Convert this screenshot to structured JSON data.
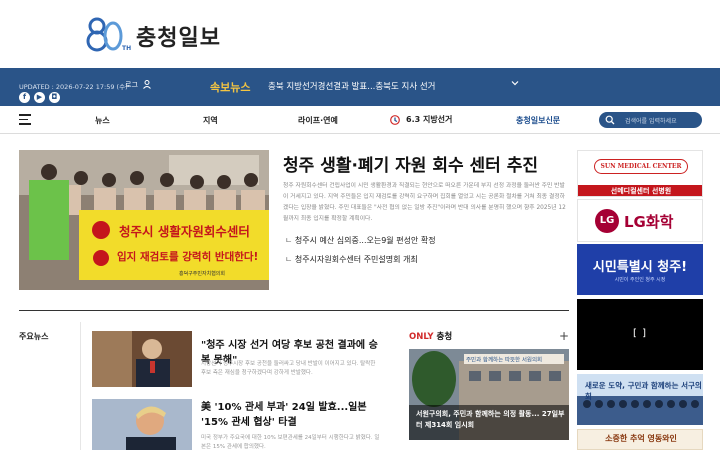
{
  "logo": {
    "anniversary": "80",
    "suffix": "TH",
    "name": "충청일보"
  },
  "topbar": {
    "updated": "UPDATED : 2026-07-22 17:59 (수)",
    "login": "로그",
    "breaking_label": "속보뉴스",
    "ticker_text": "충북 지방선거경선결과 발표...충북도 지사 선거",
    "social": [
      "f",
      "▶",
      "◘"
    ]
  },
  "nav": {
    "items": [
      "뉴스",
      "지역",
      "라이프·연예"
    ],
    "election": "6.3 지방선거",
    "highlight": "충청일보신문",
    "search_placeholder": "검색어를 입력하세요"
  },
  "hero": {
    "title": "청주 생활·폐기 자원 회수 센터 추진",
    "summary": "청주 자원회수센터 건립사업이 시민 생활환경과 직결되는 현안으로 떠오른 가운데 부지 선정 과정을 둘러싼 주민 반발이 거세지고 있다. 지역 주민들은 입지 재검토를 강력히 요구하며 집회를 열었고 시는 공론화 절차를 거쳐 최종 결정하겠다는 입장을 밝혔다. 주민 대표들은 \"사전 협의 없는 일방 추진\"이라며 반대 의사를 분명히 했으며 향후 2025년 12월까지 최종 입지를 확정할 계획이다.",
    "image_banner_line1": "청주시 생활자원회수센터",
    "image_banner_line2": "입지 재검토를 강력히 반대한다!",
    "image_banner_footer": "흥덕구주민자치협의회",
    "links": [
      "청주시 예산 심의중...오는9월 편성안 확정",
      "청주시자원회수센터 주민설명회 개최"
    ]
  },
  "left_section": {
    "label": "주요뉴스"
  },
  "news": [
    {
      "title": "\"청주 시장 선거 여당 후보 공천 결과에 승복 못해\"",
      "desc": "지방선거 청주시장 후보 공천을 둘러싸고 당내 반발이 이어지고 있다. 탈락한 후보 측은 재심을 청구하겠다며 강하게 반발했다."
    },
    {
      "title": "美 '10% 관세 부과' 24일 발효...일본 '15% 관세 협상' 타결",
      "desc": "미국 정부가 주요국에 대한 10% 보편관세를 24일부터 시행한다고 밝혔다. 일본은 15% 관세에 합의했다."
    }
  ],
  "only": {
    "label_red": "ONLY",
    "label_rest": " 충청",
    "plus": "+",
    "image_sign": "주민과 함께하는 따뜻한 서원의회",
    "caption": "서원구의회, 주민과 함께하는 의정 활동... 27일부터 제314회 임시회"
  },
  "ads": {
    "ad1_logo": "SUN MEDICAL CENTER",
    "ad1_bar": "선메디컬센터 선병원",
    "ad2_mark": "LG",
    "ad2_text": "LG화학",
    "ad3_title": "시민특별시 청주!",
    "ad3_sub": "시민이 주인인 청주 시정",
    "ad4_text": "[          ]",
    "ad5_text": "새로운 도약, 구민과 함께하는 서구의회",
    "ad6_text": "소중한 추억 영동와인"
  }
}
